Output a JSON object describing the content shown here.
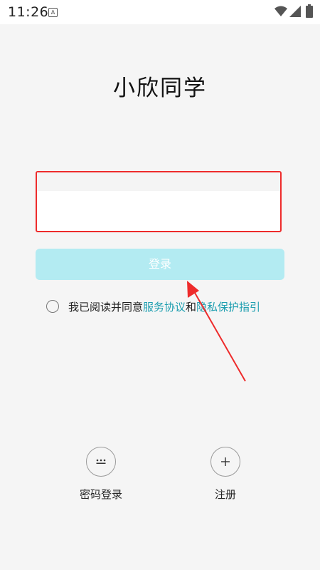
{
  "status_bar": {
    "time": "11:26",
    "app_icon_letter": "A"
  },
  "app": {
    "title": "小欣同学"
  },
  "login_form": {
    "phone_value": "",
    "phone_placeholder": "",
    "login_button_label": "登录"
  },
  "agreement": {
    "prefix": "我已阅读并同意",
    "service_link": "服务协议",
    "conjunction": "和",
    "privacy_link": "隐私保护指引"
  },
  "bottom_options": {
    "password_login_label": "密码登录",
    "register_label": "注册"
  },
  "colors": {
    "highlight_border": "#ee2b2b",
    "button_bg": "#b3ebf2",
    "link": "#1f9fb0",
    "annotation_arrow": "#ee2b2b"
  },
  "icons": {
    "password_login": "dots-icon",
    "register": "plus-icon"
  }
}
